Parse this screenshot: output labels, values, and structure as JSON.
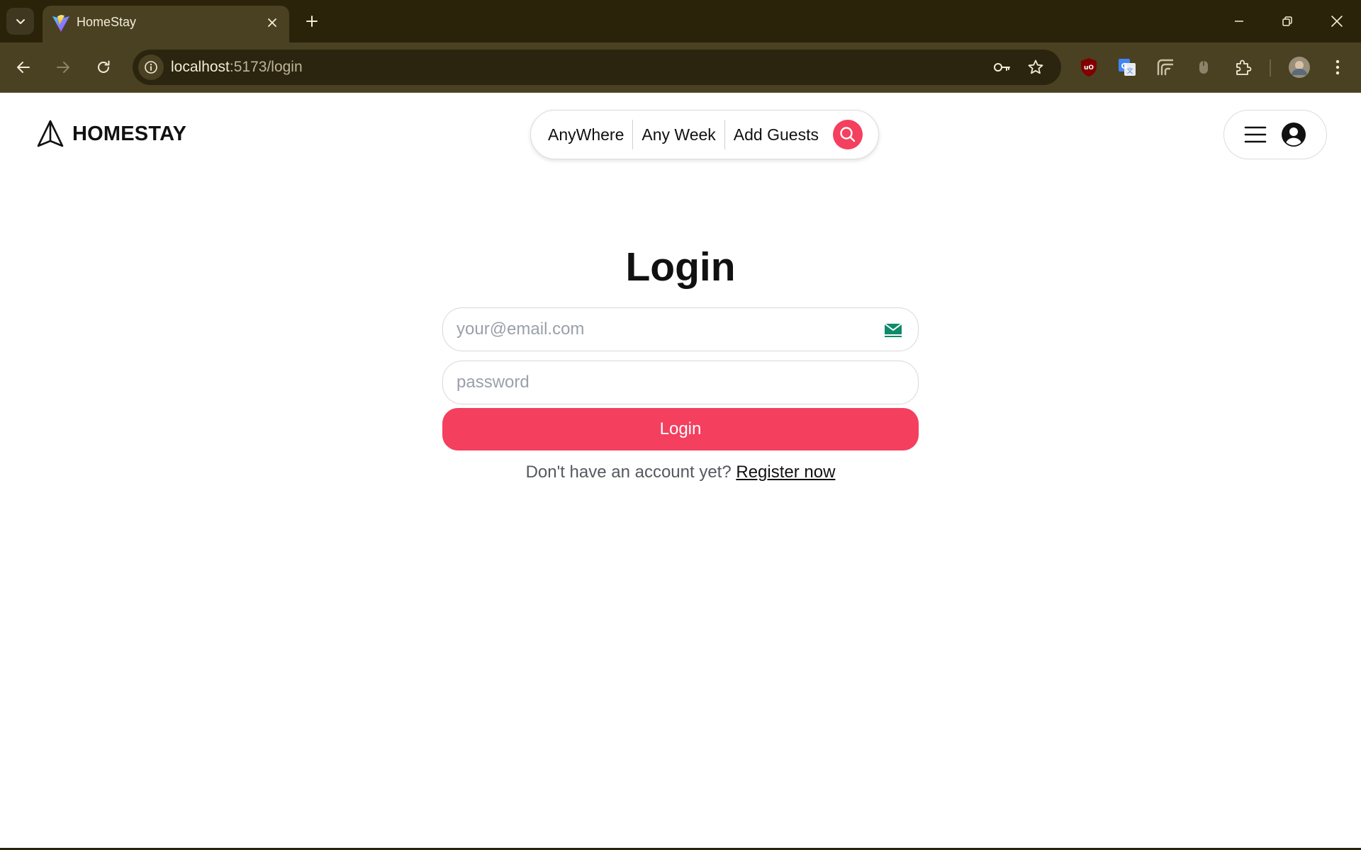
{
  "browser": {
    "tab_title": "HomeStay",
    "url_host": "localhost",
    "url_path": ":5173/login",
    "colors": {
      "frame": "#2a2209",
      "toolbar": "#4a4122",
      "omnibox": "#2b250f"
    }
  },
  "header": {
    "brand": "HOMESTAY",
    "search": {
      "where": "AnyWhere",
      "when": "Any Week",
      "guests": "Add Guests"
    }
  },
  "login": {
    "title": "Login",
    "email_placeholder": "your@email.com",
    "password_placeholder": "password",
    "submit_label": "Login",
    "register_prompt": "Don't have an account yet?",
    "register_link": "Register now"
  },
  "theme": {
    "accent": "#f43f5e"
  }
}
